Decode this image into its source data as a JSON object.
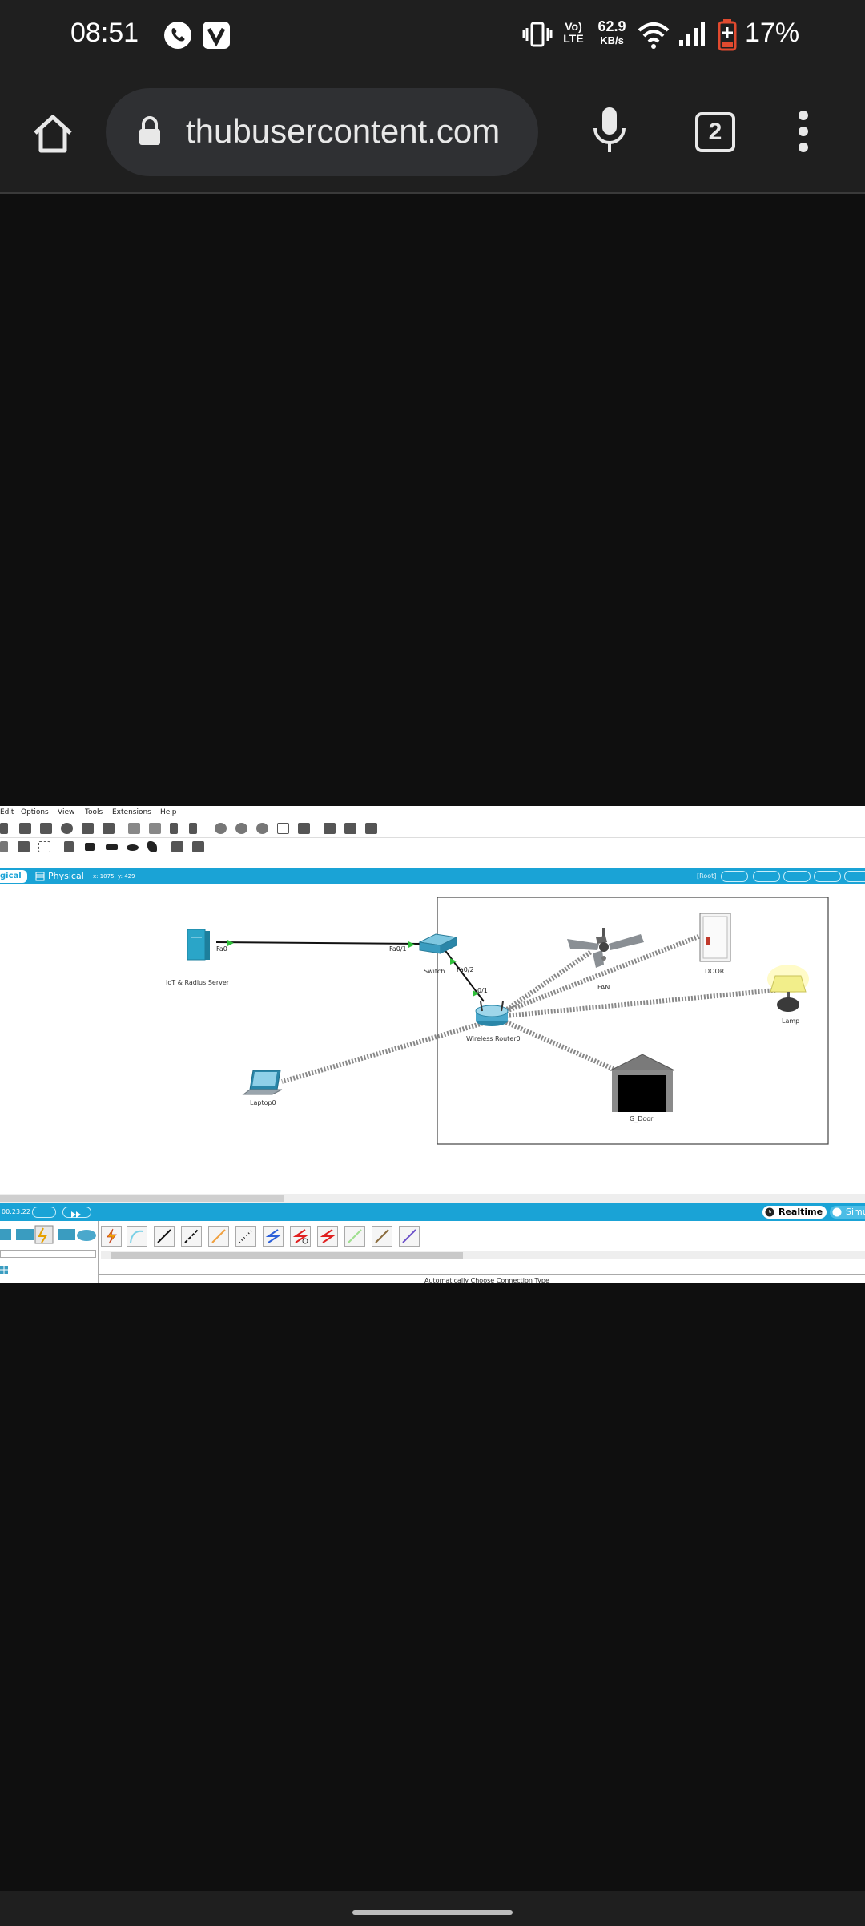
{
  "status_bar": {
    "time": "08:51",
    "volte": "Vo) LTE",
    "speed_value": "62.9",
    "speed_unit": "KB/s",
    "battery": "17%"
  },
  "browser": {
    "url": "thubusercontent.com",
    "tab_count": "2"
  },
  "packet_tracer": {
    "menu": [
      "Edit",
      "Options",
      "View",
      "Tools",
      "Extensions",
      "Help"
    ],
    "tabs": {
      "logical": "gical",
      "physical": "Physical"
    },
    "coords": "x: 1075, y: 429",
    "root": "[Root]",
    "devices": {
      "server": "IoT & Radius Server",
      "switch": "Switch",
      "router": "Wireless Router0",
      "laptop": "Laptop0",
      "fan": "FAN",
      "door": "DOOR",
      "lamp": "Lamp",
      "garage": "G_Door"
    },
    "ports": {
      "server_fa0": "Fa0",
      "switch_fa01": "Fa0/1",
      "switch_fa02": "Fa0/2",
      "router_01": "0/1"
    },
    "timer": "00:23:22",
    "realtime": "Realtime",
    "simulation": "Simu",
    "status_line": "Automatically Choose Connection Type"
  }
}
